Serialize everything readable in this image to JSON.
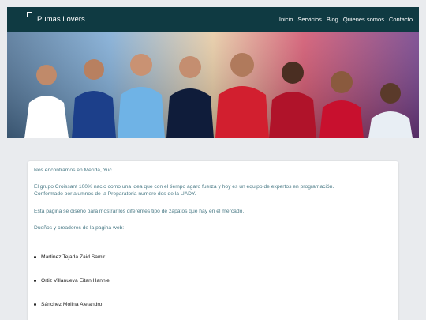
{
  "nav": {
    "brand": "Pumas Lovers",
    "links": [
      "Inicio",
      "Servicios",
      "Blog",
      "Quienes somos",
      "Contacto"
    ]
  },
  "banner": {
    "alt": "football-players-banner"
  },
  "content": {
    "location": "Nos encontramos en Merida, Yuc.",
    "about_line1": "El grupo Croissant 100% nacio como una idea que con el tiempo agaro fuerza y hoy es un equipo de expertos en programación.",
    "about_line2": "Conformado por alumnos de la Preparatoria numero dos de la UADY.",
    "purpose": "Esta pagina se diseño para mostrar los diferentes tipo de zapatos que hay en el mercado.",
    "owners_title": "Dueños y creadores de la pagina web:",
    "owners": [
      "Martinez Tejada Zaid Samir",
      "Ortiz Villanueva Eitan Hanniel",
      "Sánchez Molina Alejandro"
    ]
  }
}
